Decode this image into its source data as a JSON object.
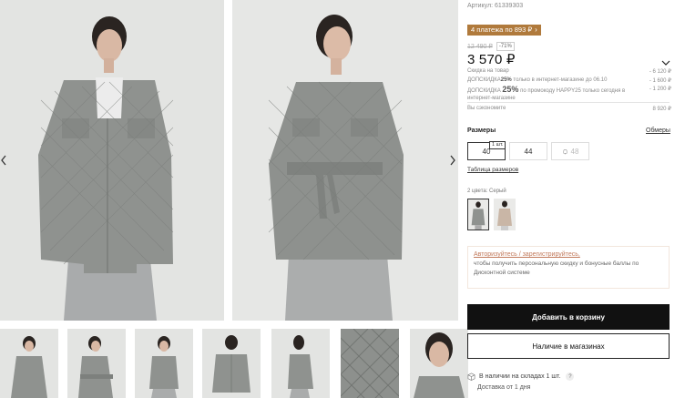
{
  "product": {
    "sku": "Артикул: 61339303",
    "installments": "4 платежа по 893 ₽",
    "old_price": "12 490 ₽",
    "discount_tag": "-71%",
    "price": "3 570 ₽"
  },
  "discounts": [
    {
      "label_pre": "Скидка на товар",
      "label_bold": "",
      "label_post": "",
      "amount": "- 6 120 ₽"
    },
    {
      "label_pre": "ДОПСКИДКА",
      "label_bold": "25%",
      "label_post": " только в интернет-магазине до 06.10",
      "amount": "- 1 600 ₽"
    },
    {
      "label_pre": "ДОПСКИДКА ",
      "label_bold": "25%",
      "label_post": " по промокоду HAPPY25 только сегодня в интернет-магазине",
      "amount": "- 1 200 ₽"
    }
  ],
  "savings": {
    "label": "Вы сэкономите",
    "amount": "8 920 ₽"
  },
  "sizes": {
    "label": "Размеры",
    "chart_link": "Обмеры",
    "options": [
      "40",
      "44",
      "48"
    ],
    "stock_hint": "1 шт.",
    "table_link": "Таблица размеров"
  },
  "colors": {
    "label": "2 цвета: Серый"
  },
  "promo": {
    "link": "Авторизуйтесь / зарегистрируйтесь,",
    "text": "чтобы получить персональную скидку и бонусные баллы по Дисконтной системе"
  },
  "actions": {
    "add_to_cart": "Добавить в корзину",
    "stores": "Наличие в магазинах"
  },
  "availability": {
    "warehouse": "В наличии на складах 1 шт.",
    "help": "?",
    "delivery": "Доставка от 1 дня"
  }
}
